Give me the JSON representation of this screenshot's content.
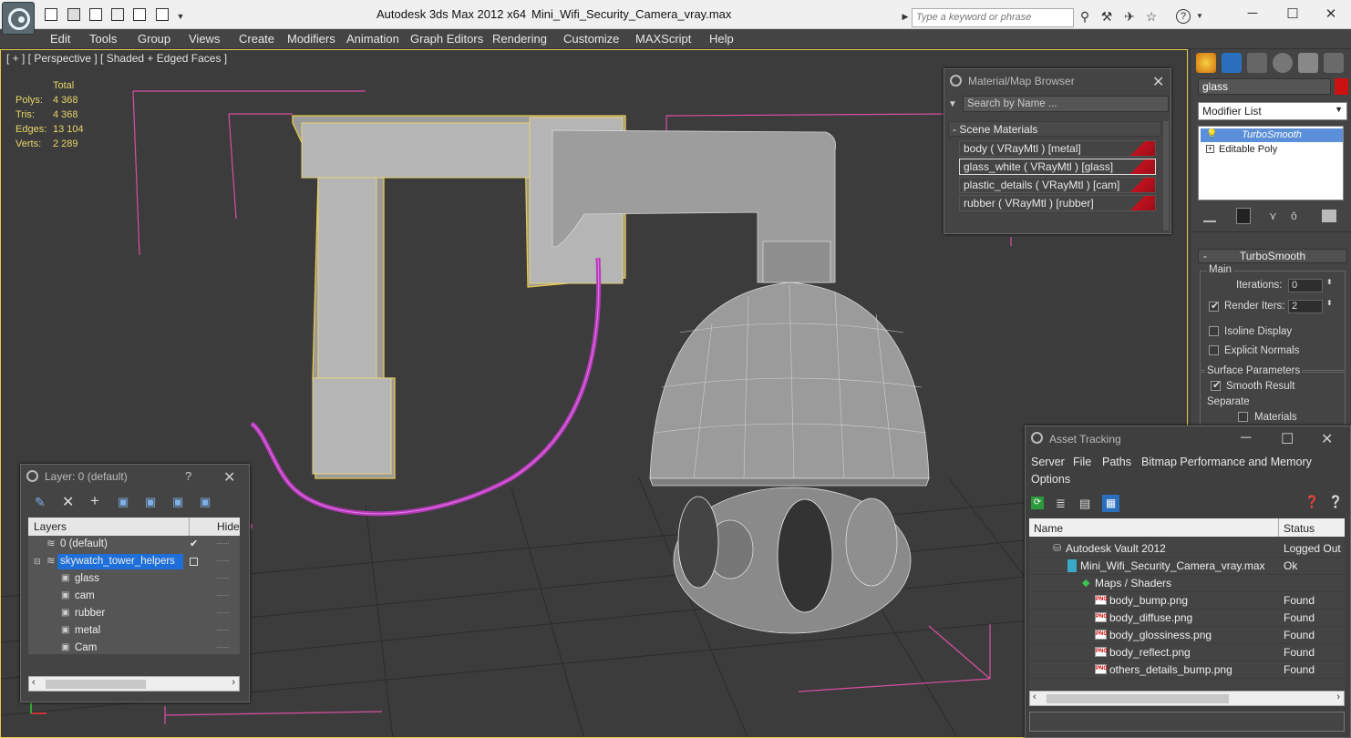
{
  "app": {
    "title": "Autodesk 3ds Max  2012 x64",
    "file": "Mini_Wifi_Security_Camera_vray.max",
    "search_placeholder": "Type a keyword or phrase"
  },
  "menu": [
    "Edit",
    "Tools",
    "Group",
    "Views",
    "Create",
    "Modifiers",
    "Animation",
    "Graph Editors",
    "Rendering",
    "Customize",
    "MAXScript",
    "Help"
  ],
  "viewport": {
    "label": "[ + ] [ Perspective ] [ Shaded + Edged Faces ]",
    "stats": {
      "header": "Total",
      "polys_label": "Polys:",
      "polys": "4 368",
      "tris_label": "Tris:",
      "tris": "4 368",
      "edges_label": "Edges:",
      "edges": "13 104",
      "verts_label": "Verts:",
      "verts": "2 289"
    }
  },
  "command_panel": {
    "object_name": "glass",
    "object_color": "#cc1111",
    "modifier_list": "Modifier List",
    "stack": [
      "TurboSmooth",
      "Editable Poly"
    ],
    "rollout_title": "TurboSmooth",
    "main_group": "Main",
    "iterations_label": "Iterations:",
    "iterations": "0",
    "render_iters_label": "Render Iters:",
    "render_iters": "2",
    "isoline_label": "Isoline Display",
    "explicit_label": "Explicit Normals",
    "surface_group": "Surface Parameters",
    "smooth_label": "Smooth Result",
    "separate_label": "Separate",
    "materials_label": "Materials"
  },
  "material_browser": {
    "title": "Material/Map Browser",
    "search_placeholder": "Search by Name ...",
    "section": "Scene Materials",
    "materials": [
      "body  ( VRayMtl ) [metal]",
      "glass_white  ( VRayMtl ) [glass]",
      "plastic_details  ( VRayMtl ) [cam]",
      "rubber  ( VRayMtl ) [rubber]"
    ]
  },
  "layer_window": {
    "title": "Layer: 0 (default)",
    "help": "?",
    "col_layers": "Layers",
    "col_hide": "Hide",
    "rows": [
      {
        "name": "0 (default)",
        "level": 0
      },
      {
        "name": "skywatch_tower_helpers",
        "level": 0
      },
      {
        "name": "glass",
        "level": 1
      },
      {
        "name": "cam",
        "level": 1
      },
      {
        "name": "rubber",
        "level": 1
      },
      {
        "name": "metal",
        "level": 1
      },
      {
        "name": "Cam",
        "level": 1
      }
    ]
  },
  "asset_tracking": {
    "title": "Asset Tracking",
    "menu": [
      "Server",
      "File",
      "Paths",
      "Bitmap Performance and Memory",
      "Options"
    ],
    "col_name": "Name",
    "col_status": "Status",
    "rows": [
      {
        "name": "Autodesk Vault 2012",
        "status": "Logged Out"
      },
      {
        "name": "Mini_Wifi_Security_Camera_vray.max",
        "status": "Ok"
      },
      {
        "name": "Maps / Shaders",
        "status": ""
      },
      {
        "name": "body_bump.png",
        "status": "Found"
      },
      {
        "name": "body_diffuse.png",
        "status": "Found"
      },
      {
        "name": "body_glossiness.png",
        "status": "Found"
      },
      {
        "name": "body_reflect.png",
        "status": "Found"
      },
      {
        "name": "others_details_bump.png",
        "status": "Found"
      }
    ]
  },
  "colors": {
    "accent_selection": "#1e6fd9",
    "wire_pink": "#d84fa0",
    "selection_yellow": "#e8c84a",
    "cable_magenta": "#b43ab8"
  }
}
